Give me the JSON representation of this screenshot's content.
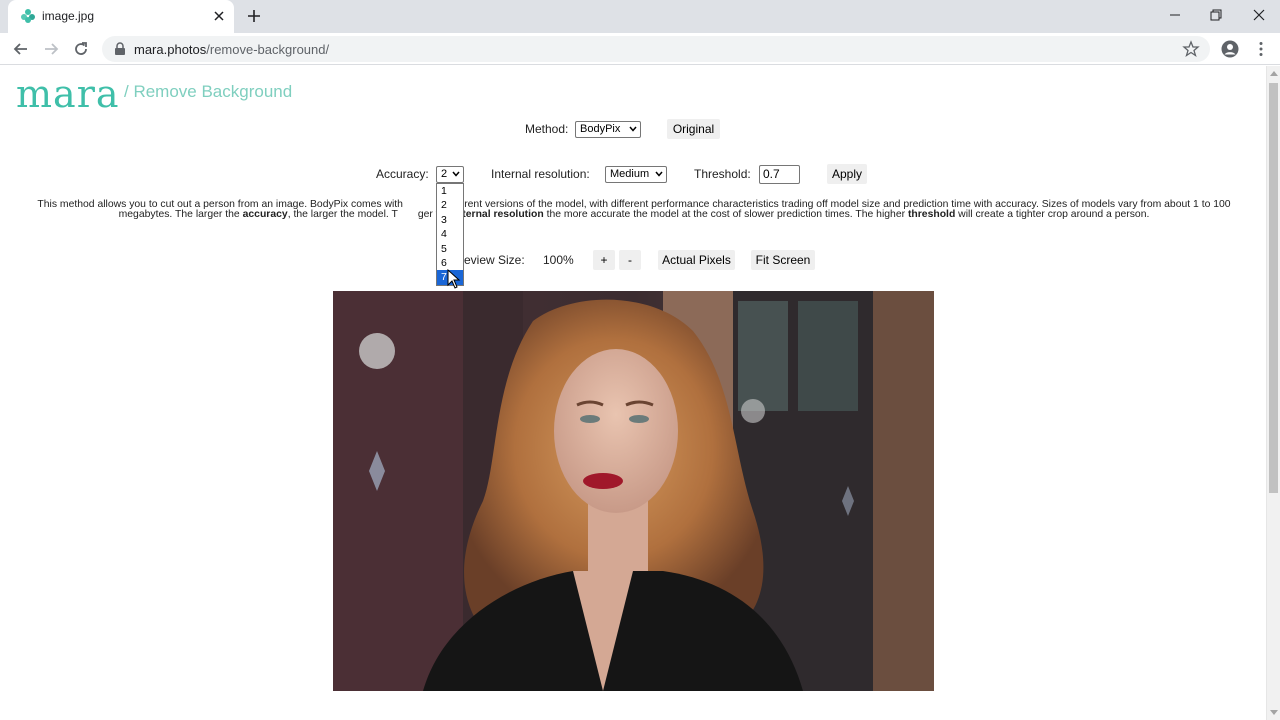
{
  "browser": {
    "tab_title": "image.jpg",
    "url_host": "mara.photos",
    "url_path": "/remove-background/"
  },
  "header": {
    "logo": "mara",
    "subtitle": "/ Remove Background"
  },
  "controls": {
    "method_label": "Method:",
    "method_value": "BodyPix",
    "original_button": "Original",
    "accuracy_label": "Accuracy:",
    "accuracy_value": "2",
    "accuracy_options": [
      "1",
      "2",
      "3",
      "4",
      "5",
      "6",
      "7"
    ],
    "accuracy_highlighted": "7",
    "resolution_label": "Internal resolution:",
    "resolution_value": "Medium",
    "threshold_label": "Threshold:",
    "threshold_value": "0.7",
    "apply_button": "Apply"
  },
  "description": {
    "part1": "This method allows you to cut out a person from an image. BodyPix comes with ",
    "part2": " different versions of the model, with different performance characteristics trading off model size and prediction time with accuracy. Sizes of models vary from about 1 to 100 megabytes. The larger the ",
    "bold1": "accuracy",
    "part3": ", the larger the model. T",
    "part4": "ger the ",
    "bold2": "internal resolution",
    "part5": " the more accurate the model at the cost of slower prediction times. The higher ",
    "bold3": "threshold",
    "part6": " will create a tighter crop around a person."
  },
  "preview": {
    "label": "eview Size:",
    "value": "100%",
    "plus_button": "+",
    "minus_button": "-",
    "actual_pixels_button": "Actual Pixels",
    "fit_screen_button": "Fit Screen"
  },
  "colors": {
    "accent": "#3fbfa9",
    "selected_option": "#1a66d6"
  }
}
